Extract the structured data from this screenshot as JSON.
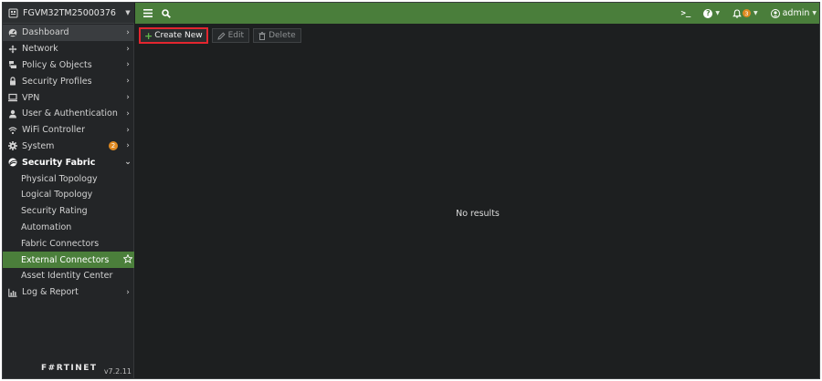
{
  "device": {
    "name": "FGVM32TM25000376"
  },
  "menu": [
    {
      "key": "dashboard",
      "label": "Dashboard",
      "icon": "dashboard-icon",
      "chevron": "›",
      "state": "active"
    },
    {
      "key": "network",
      "label": "Network",
      "icon": "network-icon",
      "chevron": "›"
    },
    {
      "key": "policy-objects",
      "label": "Policy & Objects",
      "icon": "policy-icon",
      "chevron": "›"
    },
    {
      "key": "security-profiles",
      "label": "Security Profiles",
      "icon": "lock-icon",
      "chevron": "›"
    },
    {
      "key": "vpn",
      "label": "VPN",
      "icon": "monitor-icon",
      "chevron": "›"
    },
    {
      "key": "user-auth",
      "label": "User & Authentication",
      "icon": "user-icon",
      "chevron": "›"
    },
    {
      "key": "wifi",
      "label": "WiFi Controller",
      "icon": "wifi-icon",
      "chevron": "›"
    },
    {
      "key": "system",
      "label": "System",
      "icon": "gear-icon",
      "chevron": "›",
      "badge": "2"
    },
    {
      "key": "security-fabric",
      "label": "Security Fabric",
      "icon": "fabric-icon",
      "chevron": "⌄",
      "state": "expanded"
    },
    {
      "key": "physical-topology",
      "label": "Physical Topology",
      "sub": true
    },
    {
      "key": "logical-topology",
      "label": "Logical Topology",
      "sub": true
    },
    {
      "key": "security-rating",
      "label": "Security Rating",
      "sub": true
    },
    {
      "key": "automation",
      "label": "Automation",
      "sub": true
    },
    {
      "key": "fabric-connectors",
      "label": "Fabric Connectors",
      "sub": true
    },
    {
      "key": "external-connectors",
      "label": "External Connectors",
      "sub": true,
      "state": "selected",
      "star": true
    },
    {
      "key": "asset-identity-center",
      "label": "Asset Identity Center",
      "sub": true
    },
    {
      "key": "log-report",
      "label": "Log & Report",
      "icon": "chart-icon",
      "chevron": "›"
    }
  ],
  "footer": {
    "brand": "F#RTINET",
    "version": "v7.2.11"
  },
  "header": {
    "cli": ">_",
    "help": "?",
    "notifications": "3",
    "user": "admin"
  },
  "toolbar": {
    "create_new": "Create New",
    "edit": "Edit",
    "delete": "Delete"
  },
  "content": {
    "empty_message": "No results"
  },
  "colors": {
    "header_green": "#4a7e3b",
    "selected_green": "#4b7f3b",
    "highlight_red": "#e3262f",
    "badge_orange": "#e08a21",
    "background": "#1d1f20"
  }
}
